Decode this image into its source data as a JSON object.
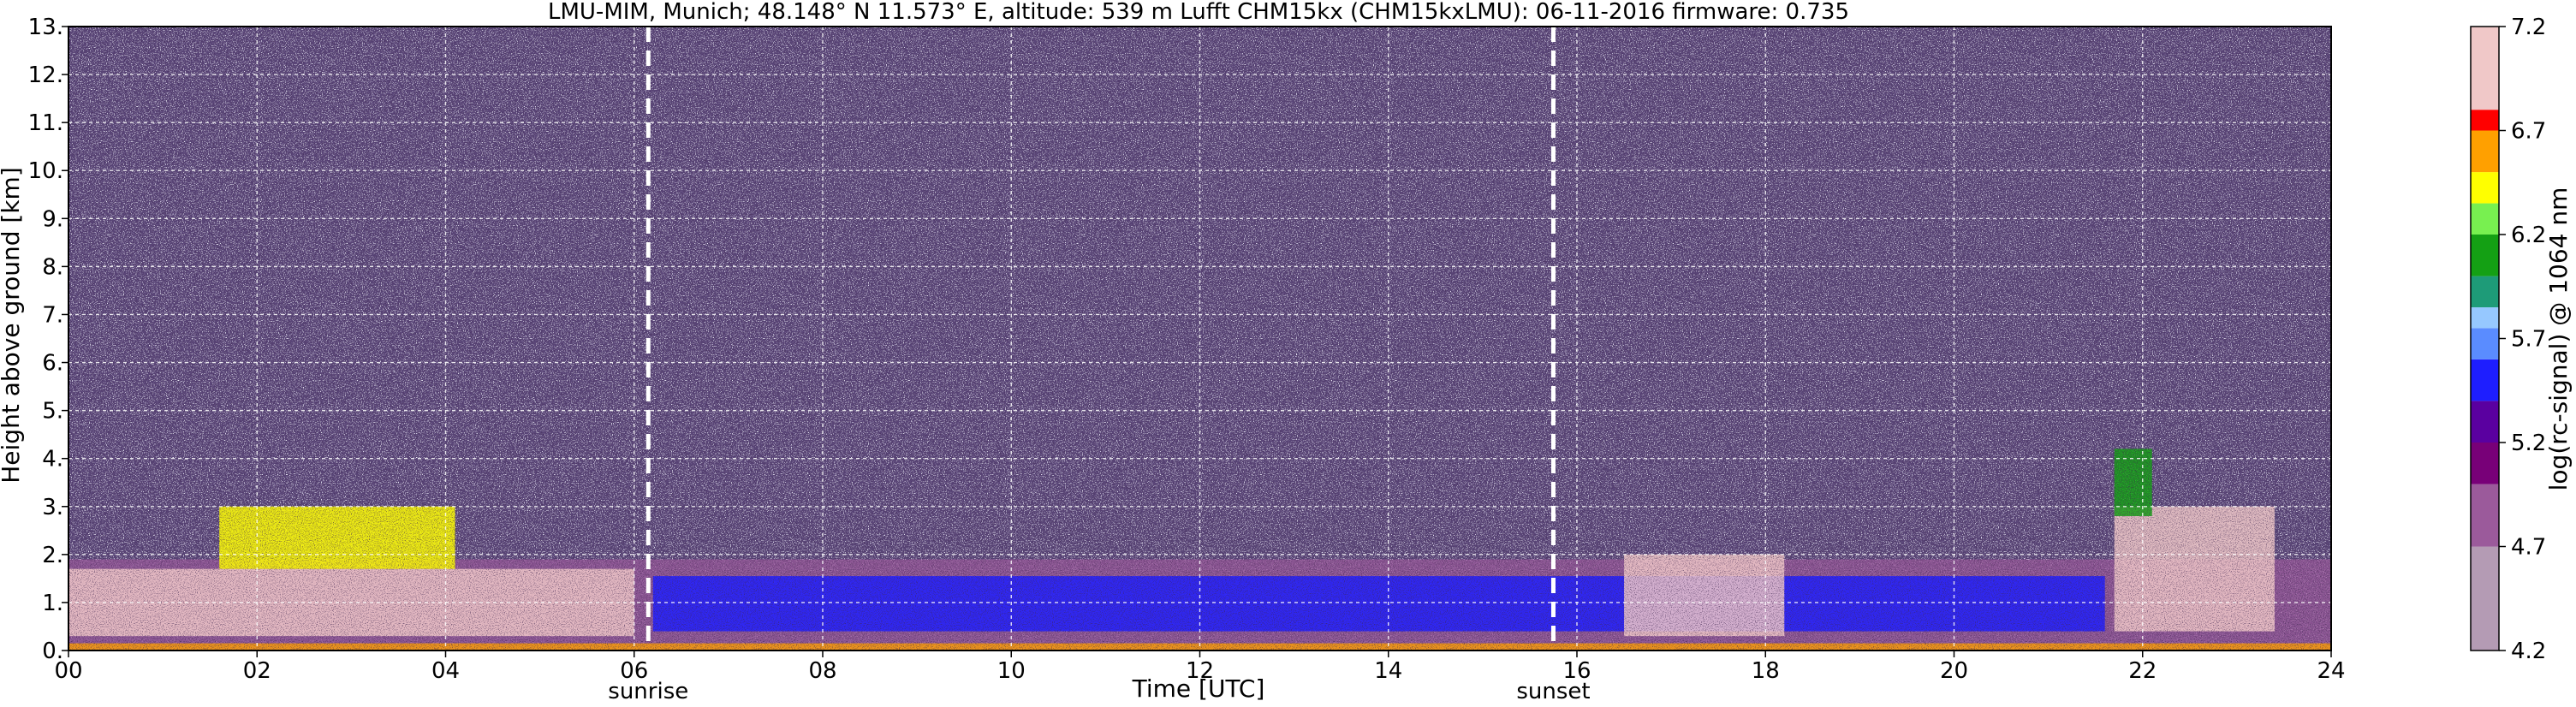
{
  "chart_data": {
    "type": "heatmap",
    "title": "LMU-MIM, Munich; 48.148° N 11.573° E, altitude: 539 m    Lufft CHM15kx (CHM15kxLMU): 06-11-2016    firmware: 0.735",
    "xlabel": "Time [UTC]",
    "ylabel": "Height above ground [km]",
    "xlim": [
      0,
      24
    ],
    "ylim": [
      0,
      13
    ],
    "x_ticks": [
      0,
      2,
      4,
      6,
      8,
      10,
      12,
      14,
      16,
      18,
      20,
      22,
      24
    ],
    "x_tick_labels": [
      "00",
      "02",
      "04",
      "06",
      "08",
      "10",
      "12",
      "14",
      "16",
      "18",
      "20",
      "22",
      "24"
    ],
    "y_ticks": [
      0,
      1,
      2,
      3,
      4,
      5,
      6,
      7,
      8,
      9,
      10,
      11,
      12,
      13
    ],
    "y_tick_labels": [
      "0.",
      "1.",
      "2.",
      "3.",
      "4.",
      "5.",
      "6.",
      "7.",
      "8.",
      "9.",
      "10.",
      "11.",
      "12.",
      "13."
    ],
    "grid": true,
    "annotations": [
      {
        "label": "sunrise",
        "x": 6.15
      },
      {
        "label": "sunset",
        "x": 15.75
      }
    ],
    "colorbar": {
      "label": "log(rc-signal) @ 1064 nm",
      "range": [
        4.2,
        7.2
      ],
      "ticks": [
        4.2,
        4.7,
        5.2,
        5.7,
        6.2,
        6.7,
        7.2
      ],
      "tick_labels": [
        "4.2",
        "4.7",
        "5.2",
        "5.7",
        "6.2",
        "6.7",
        "7.2"
      ],
      "stops": [
        {
          "v": 4.2,
          "color": "#b49bb4"
        },
        {
          "v": 4.7,
          "color": "#9b5a9b"
        },
        {
          "v": 5.0,
          "color": "#780078"
        },
        {
          "v": 5.2,
          "color": "#5a00a0"
        },
        {
          "v": 5.4,
          "color": "#1e1eff"
        },
        {
          "v": 5.6,
          "color": "#5a8cff"
        },
        {
          "v": 5.75,
          "color": "#96c8ff"
        },
        {
          "v": 5.85,
          "color": "#1e9b78"
        },
        {
          "v": 6.0,
          "color": "#14a014"
        },
        {
          "v": 6.2,
          "color": "#78f050"
        },
        {
          "v": 6.35,
          "color": "#ffff00"
        },
        {
          "v": 6.5,
          "color": "#ffa000"
        },
        {
          "v": 6.7,
          "color": "#ff0000"
        },
        {
          "v": 6.8,
          "color": "#f0c8c8"
        },
        {
          "v": 7.2,
          "color": "#ffffff"
        }
      ]
    },
    "background_color": "#5a4678",
    "features": [
      {
        "name": "boundary-layer-blue-band",
        "x": [
          6.2,
          21.6
        ],
        "height": [
          0.4,
          1.55
        ],
        "level": 5.6
      },
      {
        "name": "morning-clouds",
        "x": [
          0.0,
          6.0
        ],
        "height": [
          0.3,
          1.7
        ],
        "level": 6.9
      },
      {
        "name": "morning-cloud-tops",
        "x": [
          1.6,
          4.1
        ],
        "height": [
          1.7,
          3.0
        ],
        "level": 6.5
      },
      {
        "name": "evening-clouds",
        "x": [
          16.5,
          18.2
        ],
        "height": [
          0.3,
          2.0
        ],
        "level": 6.9
      },
      {
        "name": "night-clouds",
        "x": [
          21.7,
          23.4
        ],
        "height": [
          0.4,
          3.0
        ],
        "level": 6.9
      },
      {
        "name": "night-plume-top",
        "x": [
          21.7,
          22.1
        ],
        "height": [
          2.8,
          4.2
        ],
        "level": 6.2
      }
    ]
  }
}
